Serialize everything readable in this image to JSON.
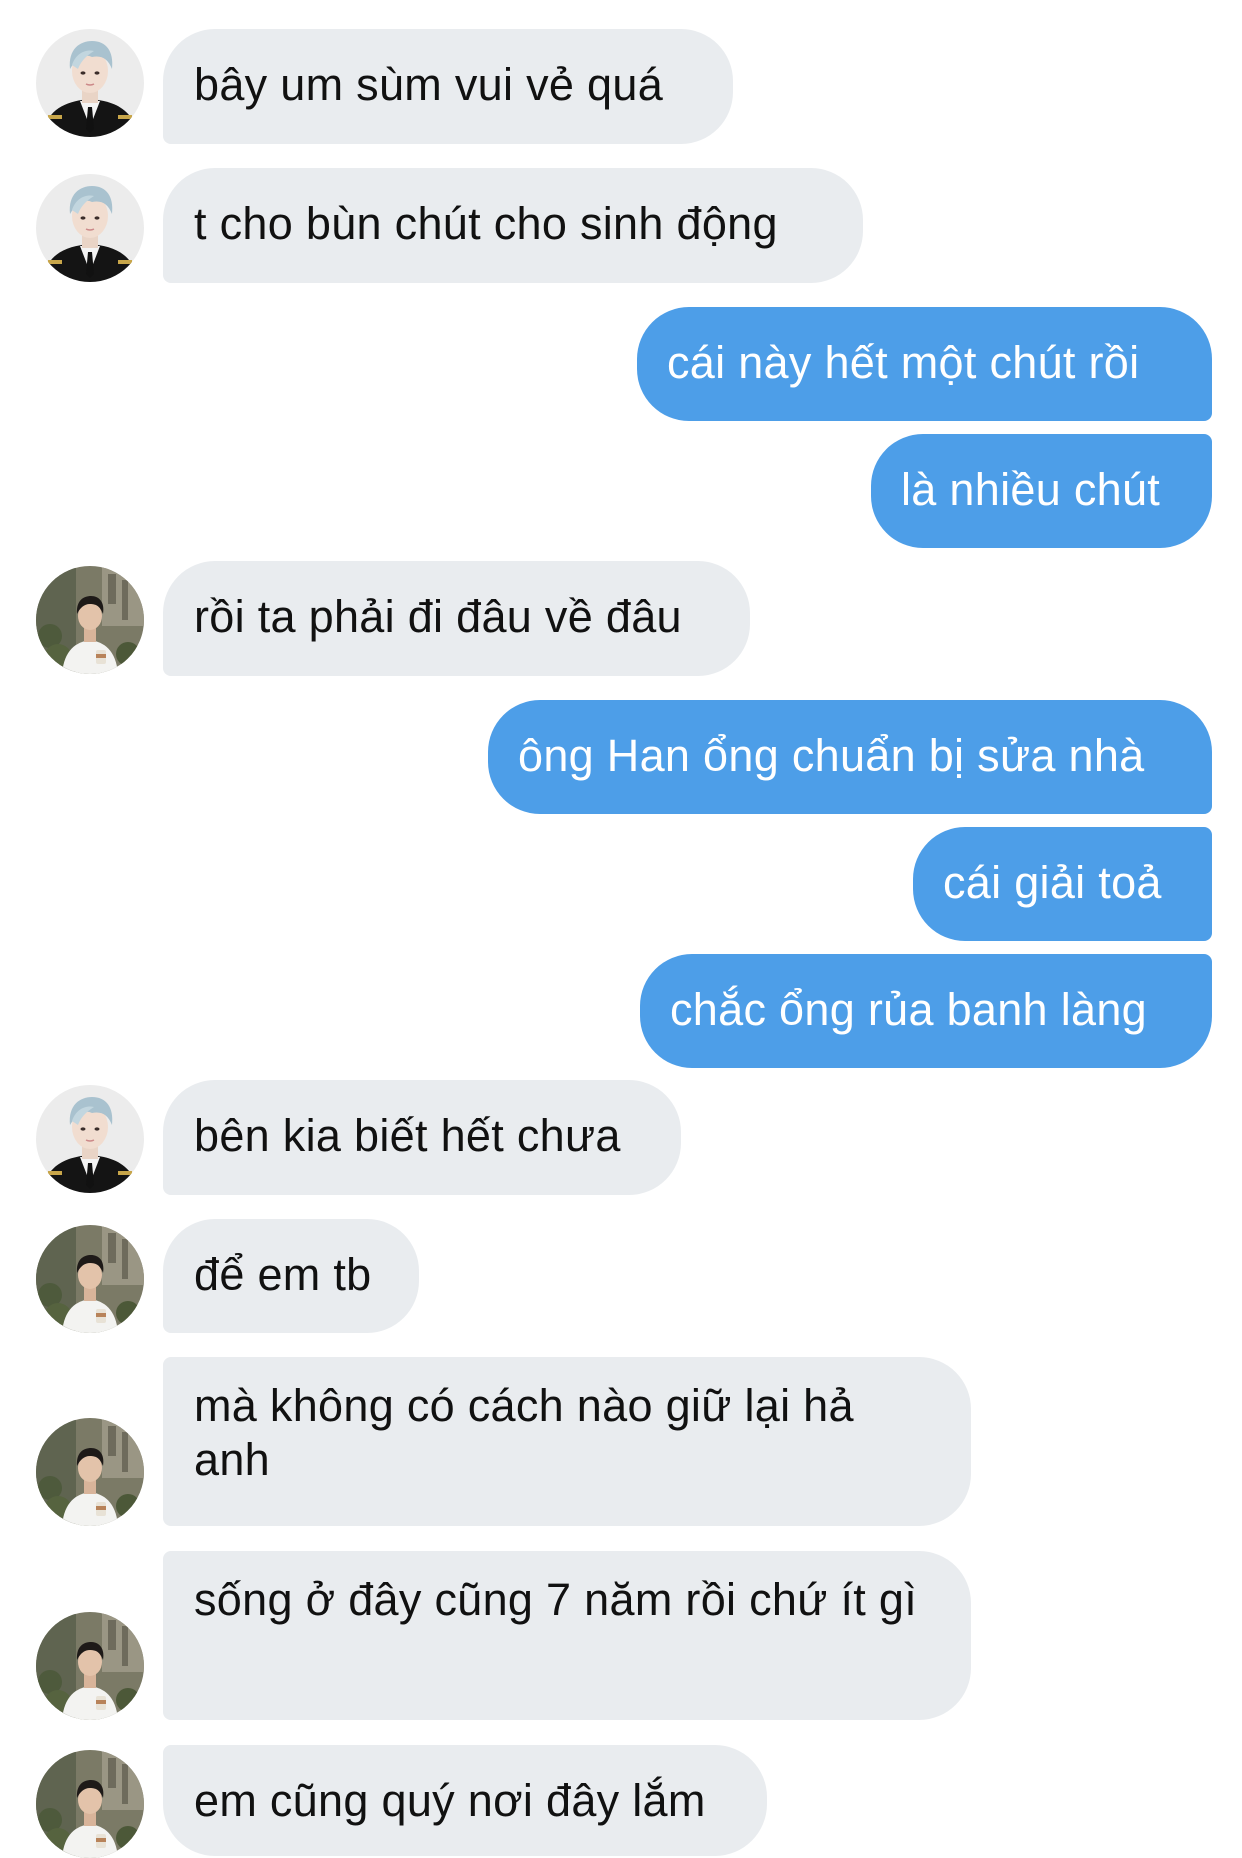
{
  "messages": [
    {
      "sender": "other_a",
      "text": "bây um sùm vui vẻ quá"
    },
    {
      "sender": "other_a",
      "text": "t cho bùn chút cho sinh động"
    },
    {
      "sender": "me",
      "text": "cái này hết một chút rồi"
    },
    {
      "sender": "me",
      "text": "là nhiều chút"
    },
    {
      "sender": "other_b",
      "text": "rồi ta phải đi đâu về đâu"
    },
    {
      "sender": "me",
      "text": "ông Han ổng chuẩn bị sửa nhà"
    },
    {
      "sender": "me",
      "text": "cái giải toả"
    },
    {
      "sender": "me",
      "text": "chắc ổng rủa banh làng"
    },
    {
      "sender": "other_a",
      "text": "bên kia biết hết chưa"
    },
    {
      "sender": "other_b",
      "text": "để em tb"
    },
    {
      "sender": "other_b",
      "text": "mà không có cách nào giữ lại hả anh"
    },
    {
      "sender": "other_b",
      "text": "sống ở đây cũng 7 năm rồi chứ ít gì"
    },
    {
      "sender": "other_b",
      "text": "em cũng quý nơi đây lắm"
    }
  ],
  "colors": {
    "incoming_bubble": "#e9ecef",
    "outgoing_bubble": "#4d9ee8",
    "incoming_text": "#111111",
    "outgoing_text": "#ffffff"
  },
  "avatars": {
    "other_a": "avatar-silver-hair-uniform",
    "other_b": "avatar-white-shirt-outdoor"
  }
}
